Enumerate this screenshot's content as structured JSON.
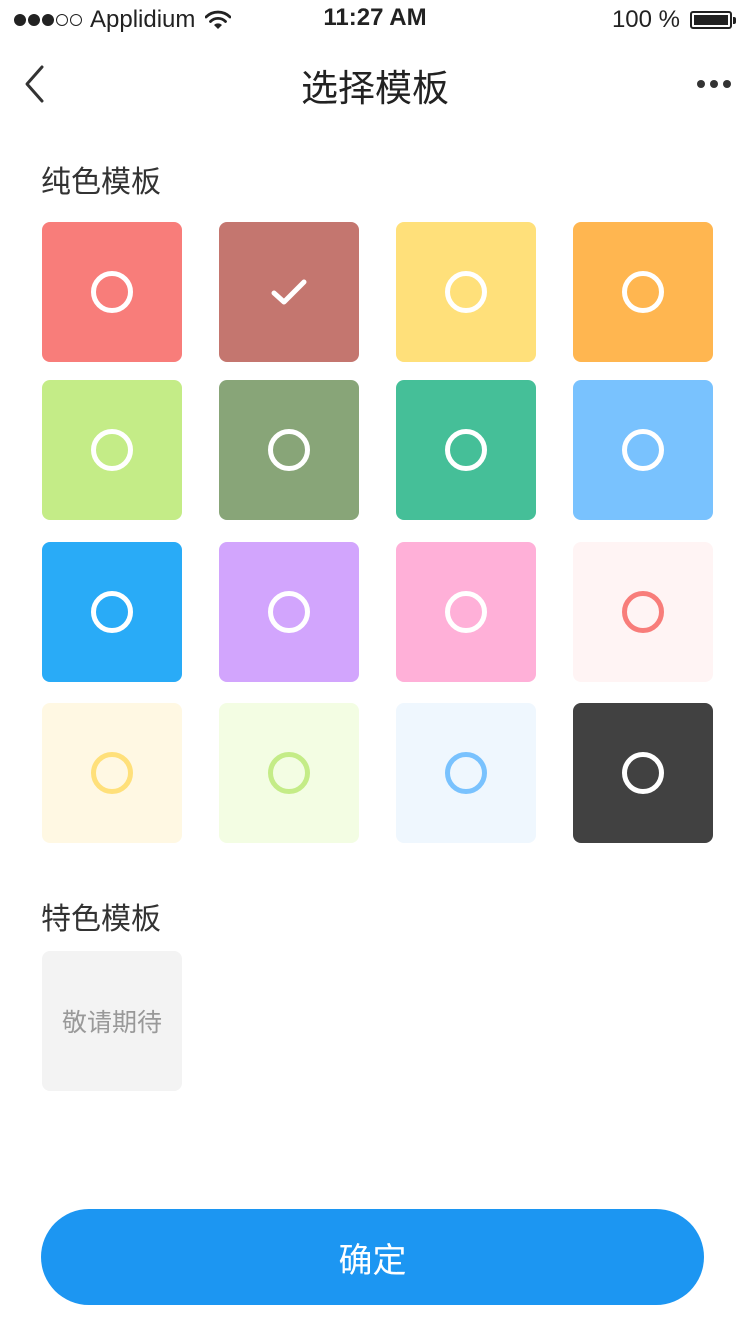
{
  "status_bar": {
    "carrier": "Applidium",
    "signal_filled": 3,
    "signal_total": 5,
    "time": "11:27 AM",
    "battery_text": "100 %",
    "battery_level": 1.0
  },
  "nav": {
    "back_icon": "chevron-left-icon",
    "title": "选择模板",
    "more_icon": "more-horizontal-icon"
  },
  "solid_section": {
    "title": "纯色模板",
    "swatches": [
      {
        "color": "#f87d7a",
        "ring": "#ffffff",
        "selected": false
      },
      {
        "color": "#c4766f",
        "ring": "#ffffff",
        "selected": true
      },
      {
        "color": "#ffe07a",
        "ring": "#ffffff",
        "selected": false
      },
      {
        "color": "#ffb650",
        "ring": "#ffffff",
        "selected": false
      },
      {
        "color": "#c4ec87",
        "ring": "#ffffff",
        "selected": false
      },
      {
        "color": "#88a578",
        "ring": "#ffffff",
        "selected": false
      },
      {
        "color": "#45bf98",
        "ring": "#ffffff",
        "selected": false
      },
      {
        "color": "#79c2fe",
        "ring": "#ffffff",
        "selected": false
      },
      {
        "color": "#29abf7",
        "ring": "#ffffff",
        "selected": false
      },
      {
        "color": "#d2a5fd",
        "ring": "#ffffff",
        "selected": false
      },
      {
        "color": "#ffb0d8",
        "ring": "#ffffff",
        "selected": false
      },
      {
        "color": "#fff4f4",
        "ring": "#f87d7a",
        "selected": false
      },
      {
        "color": "#fff8e3",
        "ring": "#ffe07a",
        "selected": false
      },
      {
        "color": "#f3fde3",
        "ring": "#c4ec87",
        "selected": false
      },
      {
        "color": "#eff7fe",
        "ring": "#79c2fe",
        "selected": false
      },
      {
        "color": "#414141",
        "ring": "#ffffff",
        "selected": false
      }
    ]
  },
  "special_section": {
    "title": "特色模板",
    "placeholder_label": "敬请期待"
  },
  "confirm_button": {
    "label": "确定",
    "color": "#1c96f2"
  }
}
